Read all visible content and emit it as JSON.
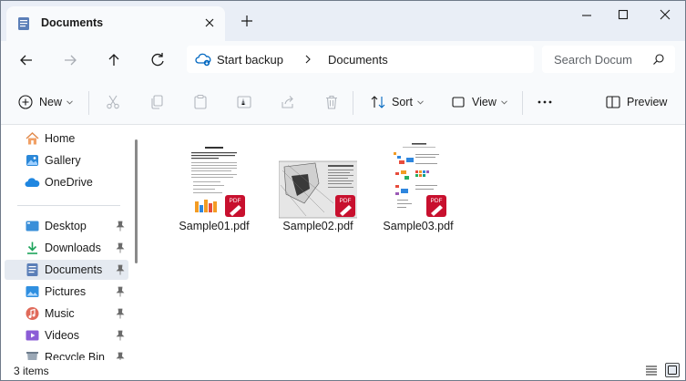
{
  "window": {
    "tab": {
      "title": "Documents",
      "icon": "documents-folder-icon"
    }
  },
  "address": {
    "crumbs": [
      "Start backup",
      "Documents"
    ],
    "search_placeholder": "Search Docum"
  },
  "toolbar": {
    "new_label": "New",
    "sort_label": "Sort",
    "view_label": "View",
    "preview_label": "Preview"
  },
  "sidebar": {
    "quick": [
      {
        "label": "Home",
        "icon": "home-icon"
      },
      {
        "label": "Gallery",
        "icon": "gallery-icon"
      },
      {
        "label": "OneDrive",
        "icon": "onedrive-cloud-icon"
      }
    ],
    "pinned": [
      {
        "label": "Desktop",
        "icon": "desktop-icon"
      },
      {
        "label": "Downloads",
        "icon": "downloads-icon"
      },
      {
        "label": "Documents",
        "icon": "documents-icon",
        "selected": true
      },
      {
        "label": "Pictures",
        "icon": "pictures-icon"
      },
      {
        "label": "Music",
        "icon": "music-icon"
      },
      {
        "label": "Videos",
        "icon": "videos-icon"
      },
      {
        "label": "Recycle Bin",
        "icon": "recycle-bin-icon"
      }
    ]
  },
  "files": [
    {
      "name": "Sample01.pdf",
      "badge": "PDF"
    },
    {
      "name": "Sample02.pdf",
      "badge": "PDF"
    },
    {
      "name": "Sample03.pdf",
      "badge": "PDF"
    }
  ],
  "status": {
    "count_text": "3 items"
  },
  "colors": {
    "accent": "#0067c0",
    "pdf_red": "#c8102e",
    "selected_bg": "#e5eaf1",
    "chrome_bg": "#f8fafc"
  }
}
